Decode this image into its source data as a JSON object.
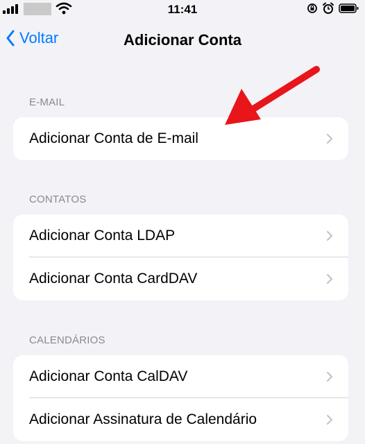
{
  "status_bar": {
    "time": "11:41"
  },
  "nav": {
    "back_label": "Voltar",
    "title": "Adicionar Conta"
  },
  "sections": [
    {
      "header": "E-MAIL",
      "rows": [
        {
          "label": "Adicionar Conta de E-mail"
        }
      ]
    },
    {
      "header": "CONTATOS",
      "rows": [
        {
          "label": "Adicionar Conta LDAP"
        },
        {
          "label": "Adicionar Conta CardDAV"
        }
      ]
    },
    {
      "header": "CALENDÁRIOS",
      "rows": [
        {
          "label": "Adicionar Conta CalDAV"
        },
        {
          "label": "Adicionar Assinatura de Calendário"
        }
      ]
    }
  ],
  "colors": {
    "accent": "#007aff",
    "background": "#f2f2f7",
    "annotation_arrow": "#e8151b"
  }
}
